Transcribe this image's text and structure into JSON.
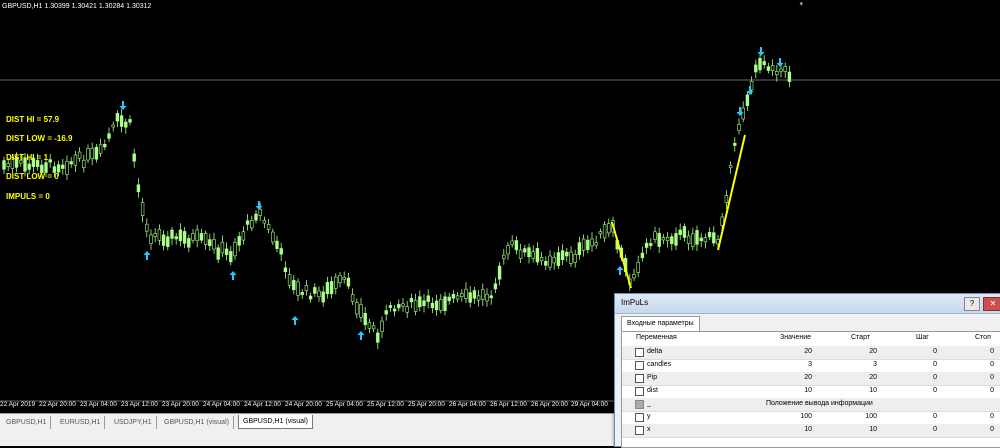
{
  "chart": {
    "title": "GBPUSD,H1  1.30399 1.30421 1.30284 1.30312",
    "colors": {
      "background": "#000000",
      "bull": "#aaff88",
      "bear": "#ffffff",
      "arrow": "#22ccff",
      "impulse": "#ffff00",
      "line": "#888888"
    },
    "overlay": [
      "DIST HI  = 57.9",
      "DIST LOW = -16.9",
      "DIST HI = 1",
      "DIST LOW = 0",
      "IMPULS = 0"
    ],
    "time_labels": [
      "22 Apr 2019",
      "22 Apr 20:00",
      "23 Apr 04:00",
      "23 Apr 12:00",
      "23 Apr 20:00",
      "24 Apr 04:00",
      "24 Apr 12:00",
      "24 Apr 20:00",
      "25 Apr 04:00",
      "25 Apr 12:00",
      "25 Apr 20:00",
      "26 Apr 04:00",
      "26 Apr 12:00",
      "26 Apr 20:00",
      "29 Apr 04:00"
    ],
    "corner_marker": "▾"
  },
  "tabs": [
    "GBPUSD,H1",
    "EURUSD,H1",
    "USDJPY,H1",
    "GBPUSD,H1 (visual)",
    "GBPUSD,H1 (visual)"
  ],
  "dialog": {
    "title": "ImPuLs",
    "help": "?",
    "close": "✕",
    "tab": "Входные параметры",
    "columns": [
      "Переменная",
      "Значение",
      "Старт",
      "Шаг",
      "Стоп"
    ],
    "rows": [
      {
        "name": "delta",
        "value": "20",
        "start": "20",
        "step": "0",
        "stop": "0"
      },
      {
        "name": "candles",
        "value": "3",
        "start": "3",
        "step": "0",
        "stop": "0"
      },
      {
        "name": "Pip",
        "value": "20",
        "start": "20",
        "step": "0",
        "stop": "0"
      },
      {
        "name": "dist",
        "value": "10",
        "start": "10",
        "step": "0",
        "stop": "0"
      },
      {
        "name": "_",
        "value": "Положение вывода информации",
        "start": "",
        "step": "",
        "stop": ""
      },
      {
        "name": "y",
        "value": "100",
        "start": "100",
        "step": "0",
        "stop": "0"
      },
      {
        "name": "x",
        "value": "10",
        "start": "10",
        "step": "0",
        "stop": "0"
      }
    ]
  }
}
